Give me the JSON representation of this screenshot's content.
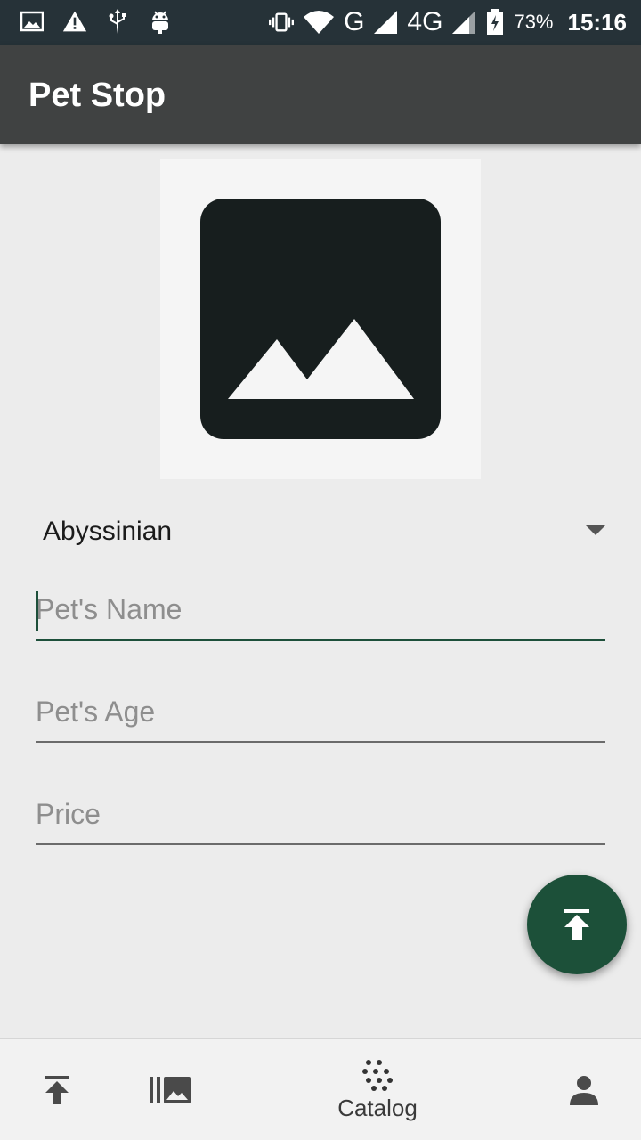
{
  "status_bar": {
    "battery_percent": "73%",
    "time": "15:16",
    "network_g": "G",
    "network_4g": "4G",
    "icons": [
      "gallery-notification-icon",
      "warning-icon",
      "usb-icon",
      "android-debug-icon",
      "vibrate-icon",
      "wifi-icon",
      "signal-icon",
      "battery-charging-icon"
    ]
  },
  "app_bar": {
    "title": "Pet Stop"
  },
  "image": {
    "icon": "image-placeholder-icon"
  },
  "breed_spinner": {
    "selected": "Abyssinian"
  },
  "form": {
    "name_placeholder": "Pet's Name",
    "age_placeholder": "Pet's Age",
    "price_placeholder": "Price",
    "name_value": "",
    "age_value": "",
    "price_value": ""
  },
  "fab": {
    "icon": "upload-icon"
  },
  "bottom_nav": {
    "items": [
      {
        "icon": "upload-icon",
        "label": ""
      },
      {
        "icon": "gallery-icon",
        "label": ""
      },
      {
        "icon": "catalog-icon",
        "label": "Catalog"
      },
      {
        "icon": "person-icon",
        "label": ""
      }
    ]
  },
  "colors": {
    "status_bar_bg": "#263238",
    "app_bar_bg": "#404242",
    "accent": "#1c5039",
    "page_bg": "#ececec"
  }
}
